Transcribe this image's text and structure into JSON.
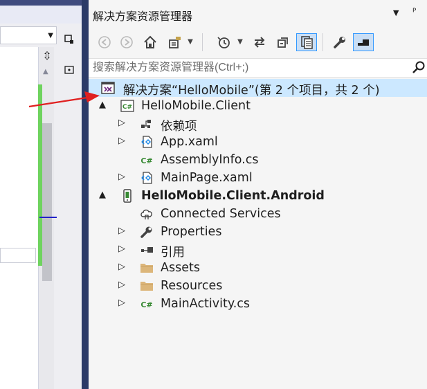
{
  "solution_explorer": {
    "title": "解决方案资源管理器",
    "title_menu_glyph": "▼",
    "title_pin_glyph": "ᴾ",
    "search": {
      "placeholder": "搜索解决方案资源管理器(Ctrl+;)",
      "value": ""
    },
    "toolbar": {
      "back": "back-icon",
      "forward": "forward-icon",
      "home": "home-icon",
      "switch_views": "switch-views-icon",
      "pending_changes": "history-icon",
      "sync": "sync-icon",
      "collapse_all": "collapse-all-icon",
      "show_all_files": "show-all-files-icon",
      "properties": "wrench-icon",
      "preview": "preview-icon"
    },
    "tree": [
      {
        "label": "解决方案“HelloMobile”(第 2 个项目，共 2 个)",
        "icon": "solution-icon",
        "level": 0,
        "expander": "",
        "bold": false,
        "selected": true
      },
      {
        "label": "HelloMobile.Client",
        "icon": "csharp-project-icon",
        "level": 1,
        "expander": "▲",
        "bold": false
      },
      {
        "label": "依赖项",
        "icon": "dependencies-icon",
        "level": 2,
        "expander": "▷",
        "bold": false
      },
      {
        "label": "App.xaml",
        "icon": "xaml-icon",
        "level": 2,
        "expander": "▷",
        "bold": false
      },
      {
        "label": "AssemblyInfo.cs",
        "icon": "csharp-file-icon",
        "level": 2,
        "expander": "",
        "bold": false
      },
      {
        "label": "MainPage.xaml",
        "icon": "xaml-icon",
        "level": 2,
        "expander": "▷",
        "bold": false
      },
      {
        "label": "HelloMobile.Client.Android",
        "icon": "android-project-icon",
        "level": 1,
        "expander": "▲",
        "bold": true
      },
      {
        "label": "Connected Services",
        "icon": "connected-services-icon",
        "level": 2,
        "expander": "",
        "bold": false
      },
      {
        "label": "Properties",
        "icon": "wrench-icon",
        "level": 2,
        "expander": "▷",
        "bold": false
      },
      {
        "label": "引用",
        "icon": "references-icon",
        "level": 2,
        "expander": "▷",
        "bold": false
      },
      {
        "label": "Assets",
        "icon": "folder-icon",
        "level": 2,
        "expander": "▷",
        "bold": false
      },
      {
        "label": "Resources",
        "icon": "folder-icon",
        "level": 2,
        "expander": "▷",
        "bold": false
      },
      {
        "label": "MainActivity.cs",
        "icon": "csharp-file-icon",
        "level": 2,
        "expander": "▷",
        "bold": false
      }
    ]
  },
  "colors": {
    "selected_row": "#cce8ff",
    "accent": "#3399ff",
    "annotation_arrow": "#e02020",
    "window_frame": "#2b3a67"
  }
}
